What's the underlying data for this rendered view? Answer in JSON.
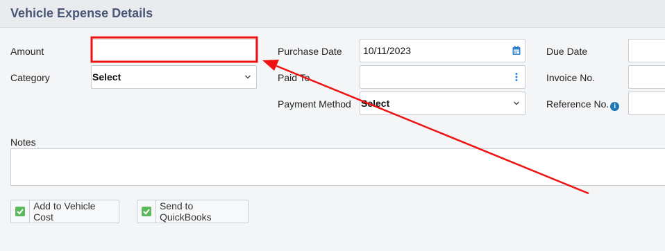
{
  "header": {
    "title": "Vehicle Expense Details"
  },
  "form": {
    "amount_label": "Amount",
    "amount_value": "",
    "category_label": "Category",
    "category_value": "Select",
    "purchase_date_label": "Purchase Date",
    "purchase_date_value": "10/11/2023",
    "paid_to_label": "Paid To",
    "paid_to_value": "",
    "payment_method_label": "Payment Method",
    "payment_method_value": "Select",
    "due_date_label": "Due Date",
    "invoice_label": "Invoice No.",
    "reference_label": "Reference No.",
    "reference_info_icon": "i",
    "notes_label": "Notes",
    "notes_value": ""
  },
  "actions": {
    "add_to_vehicle_cost": "Add to Vehicle Cost",
    "send_to_quickbooks": "Send to QuickBooks"
  },
  "colors": {
    "highlight": "#ee1111",
    "check": "#5cb85c",
    "title": "#4a5677",
    "info": "#1f78b4",
    "calendar": "#2f80d1"
  },
  "icons": [
    "calendar-icon",
    "kebab-icon",
    "chevron-down-icon",
    "info-icon",
    "check-icon"
  ]
}
